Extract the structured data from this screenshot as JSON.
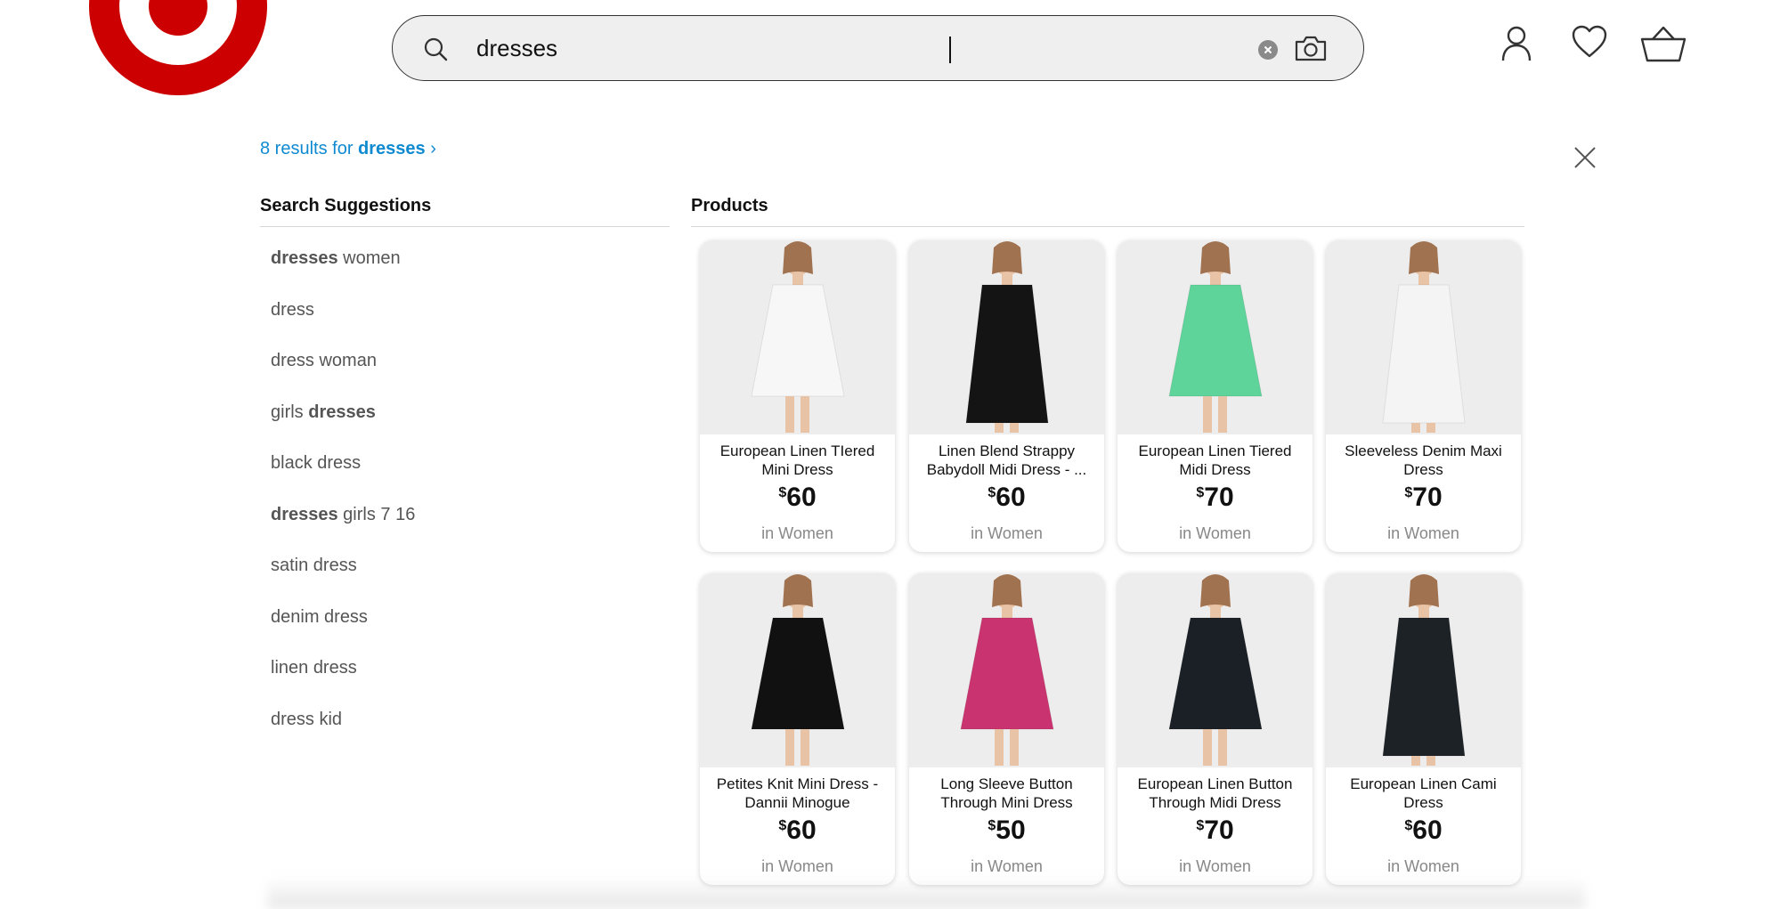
{
  "header": {
    "logo_icon": "target-bullseye-logo",
    "brand_color": "#cc0000",
    "search": {
      "value": "dresses",
      "placeholder": "",
      "icons": [
        "search-icon",
        "clear-icon",
        "camera-icon"
      ]
    },
    "actions": [
      "account-icon",
      "heart-icon",
      "cart-icon"
    ]
  },
  "results": {
    "count_prefix": "8 results for",
    "query": "dresses",
    "arrow": "›"
  },
  "suggestions": {
    "title": "Search Suggestions",
    "items": [
      {
        "bold": "dresses",
        "text": " women"
      },
      {
        "bold": "",
        "text": "dress"
      },
      {
        "bold": "",
        "text": "dress woman"
      },
      {
        "prefix": "girls ",
        "bold": "dresses",
        "text": ""
      },
      {
        "bold": "",
        "text": "black dress"
      },
      {
        "bold": "dresses",
        "text": " girls 7 16"
      },
      {
        "bold": "",
        "text": "satin dress"
      },
      {
        "bold": "",
        "text": "denim dress"
      },
      {
        "bold": "",
        "text": "linen dress"
      },
      {
        "bold": "",
        "text": "dress kid"
      }
    ]
  },
  "products": {
    "title": "Products",
    "items": [
      {
        "name": "European Linen TIered Mini Dress",
        "currency": "$",
        "price": "60",
        "category": "in Women",
        "dress_color": "#f7f7f7"
      },
      {
        "name": "Linen Blend Strappy Babydoll Midi Dress - ...",
        "currency": "$",
        "price": "60",
        "category": "in Women",
        "dress_color": "#141414"
      },
      {
        "name": "European Linen Tiered Midi Dress",
        "currency": "$",
        "price": "70",
        "category": "in Women",
        "dress_color": "#5ed39a"
      },
      {
        "name": "Sleeveless Denim Maxi Dress",
        "currency": "$",
        "price": "70",
        "category": "in Women",
        "dress_color": "#f4f4f4"
      },
      {
        "name": "Petites Knit Mini Dress - Dannii Minogue",
        "currency": "$",
        "price": "60",
        "category": "in Women",
        "dress_color": "#111111"
      },
      {
        "name": "Long Sleeve Button Through Mini Dress",
        "currency": "$",
        "price": "50",
        "category": "in Women",
        "dress_color": "#c9336f"
      },
      {
        "name": "European Linen Button Through Midi Dress",
        "currency": "$",
        "price": "70",
        "category": "in Women",
        "dress_color": "#1b2026"
      },
      {
        "name": "European Linen Cami Dress",
        "currency": "$",
        "price": "60",
        "category": "in Women",
        "dress_color": "#1d2226"
      }
    ]
  }
}
